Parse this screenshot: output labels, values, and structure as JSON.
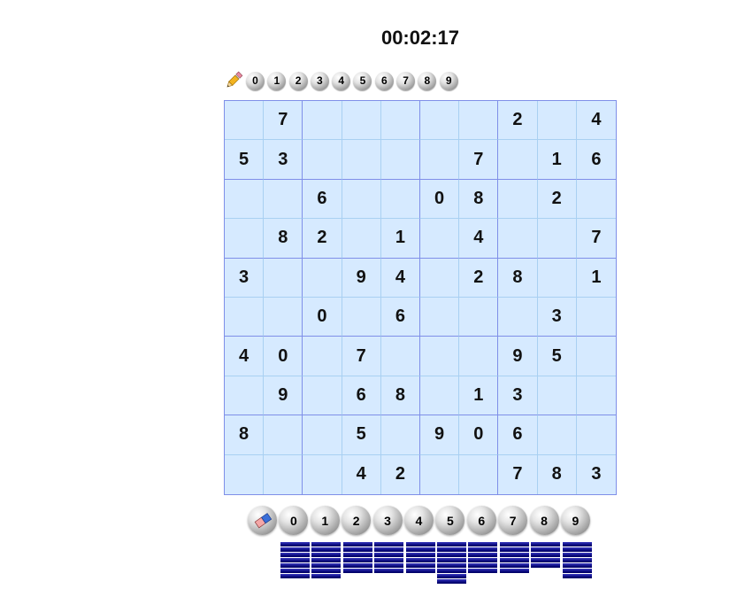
{
  "timer": "00:02:17",
  "pencil_digits": [
    "0",
    "1",
    "2",
    "3",
    "4",
    "5",
    "6",
    "7",
    "8",
    "9"
  ],
  "big_digits": [
    "0",
    "1",
    "2",
    "3",
    "4",
    "5",
    "6",
    "7",
    "8",
    "9"
  ],
  "icons": {
    "pencil": "pencil-icon",
    "eraser": "eraser-icon"
  },
  "colors": {
    "cell_bg": "#d6eaff",
    "thin_line": "#a9d0f2",
    "block_line": "#7f8fe8",
    "bar": "#0a0a80"
  },
  "grid": [
    [
      "",
      "7",
      "",
      "",
      "",
      "",
      "",
      "2",
      "",
      "4"
    ],
    [
      "5",
      "3",
      "",
      "",
      "",
      "",
      "7",
      "",
      "1",
      "6"
    ],
    [
      "",
      "",
      "6",
      "",
      "",
      "0",
      "8",
      "",
      "2",
      ""
    ],
    [
      "",
      "8",
      "2",
      "",
      "1",
      "",
      "4",
      "",
      "",
      "7"
    ],
    [
      "3",
      "",
      "",
      "9",
      "4",
      "",
      "2",
      "8",
      "",
      "1"
    ],
    [
      "",
      "",
      "0",
      "",
      "6",
      "",
      "",
      "",
      "3",
      ""
    ],
    [
      "4",
      "0",
      "",
      "7",
      "",
      "",
      "",
      "9",
      "5",
      ""
    ],
    [
      "",
      "9",
      "",
      "6",
      "8",
      "",
      "1",
      "3",
      "",
      ""
    ],
    [
      "8",
      "",
      "",
      "5",
      "",
      "9",
      "0",
      "6",
      "",
      ""
    ],
    [
      "",
      "",
      "",
      "4",
      "2",
      "",
      "",
      "7",
      "8",
      "3"
    ]
  ],
  "digit_remaining_bars": [
    7,
    7,
    6,
    6,
    6,
    8,
    6,
    6,
    5,
    7
  ]
}
